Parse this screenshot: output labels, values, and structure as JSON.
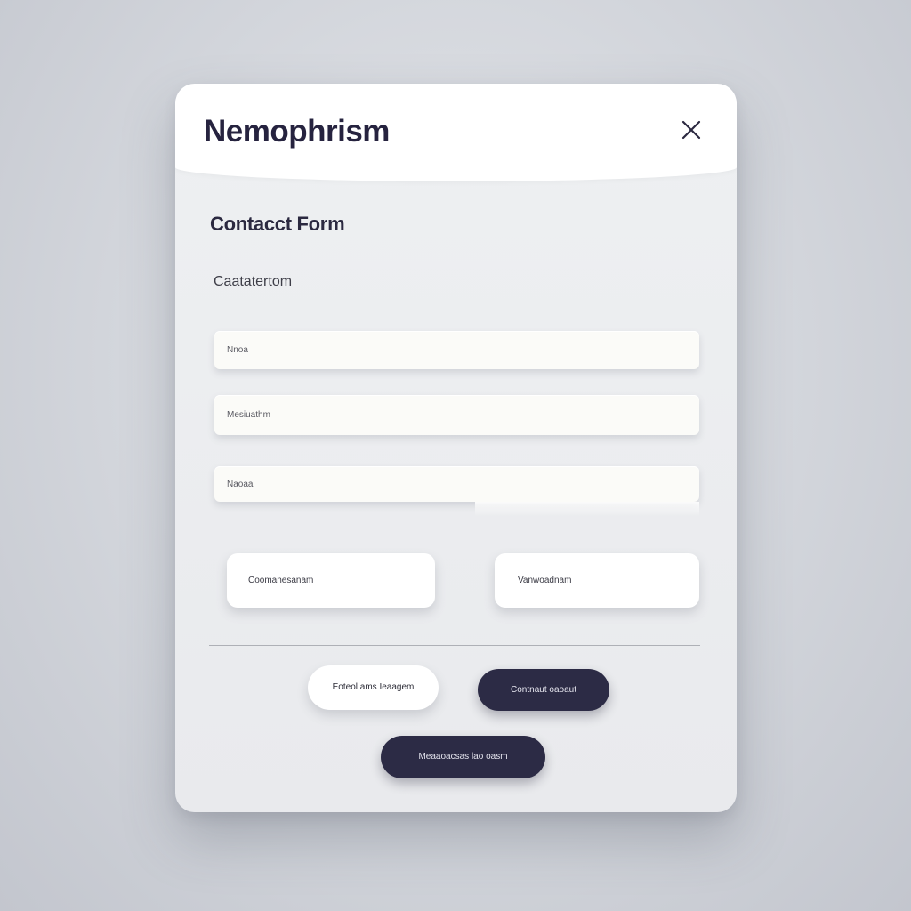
{
  "window": {
    "title": "Nemophrism",
    "close_icon": "close-icon"
  },
  "form": {
    "title": "Contacct Form",
    "subtitle": "Caatatertom",
    "fields": [
      {
        "placeholder": "Nnoa"
      },
      {
        "placeholder": "Mesiuathm"
      },
      {
        "placeholder": "Naoaa"
      }
    ],
    "options": [
      {
        "label": "Coomanesanam"
      },
      {
        "label": "Vanwoadnam"
      }
    ],
    "actions": [
      {
        "label": "Eoteol ams Ieaagem"
      },
      {
        "label": "Contnaut oaoaut"
      },
      {
        "label": "Meaaoacsas lao oasm"
      }
    ]
  },
  "colors": {
    "accent_dark": "#2c2b45",
    "title_text": "#26233f",
    "card_bg": "#eceef0",
    "page_bg": "#d2d5db"
  }
}
